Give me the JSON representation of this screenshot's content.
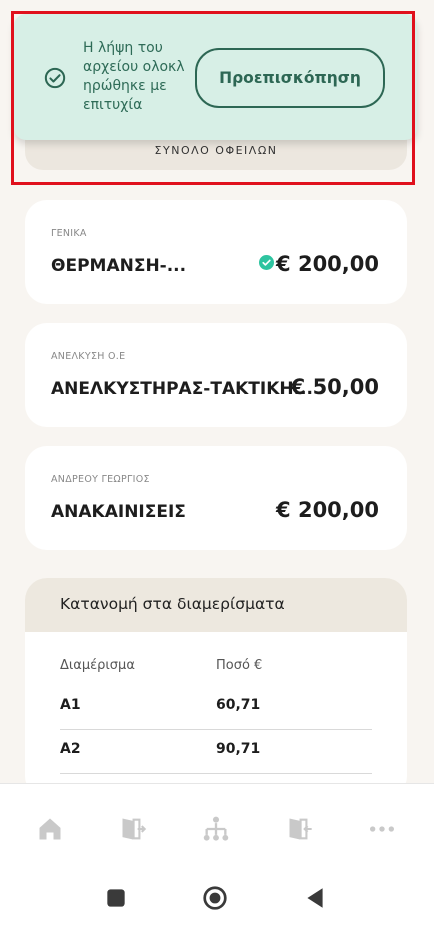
{
  "summary": {
    "label": "ΣΥΝΟΛΟ ΟΦΕΙΛΩΝ"
  },
  "toast": {
    "message_line1": "Η λήψη του",
    "message_line2": "αρχείου ολοκλ",
    "message_line3": "ηρώθηκε με",
    "message_line4": "επιτυχία",
    "preview_label": "Προεπισκόπηση",
    "icon": "check-circle-icon"
  },
  "expenses": [
    {
      "category": "ΓΕΝΙΚΑ",
      "title": "ΘΕΡΜΑΝΣΗ-...",
      "amount": "€ 200,00",
      "paid_icon": "check-badge-icon"
    },
    {
      "category": "ΑΝΕΛΚΥΣΗ Ο.Ε",
      "title": "ΑΝΕΛΚΥΣΤΗΡΑΣ-ΤΑΚΤΙΚΗ...",
      "amount": "€ 50,00"
    },
    {
      "category": "ΑΝΔΡΕΟΥ ΓΕΩΡΓΙΟΣ",
      "title": "ΑΝΑΚΑΙΝΙΣΕΙΣ",
      "amount": "€ 200,00"
    }
  ],
  "allocation": {
    "title": "Κατανομή στα διαμερίσματα",
    "columns": [
      "Διαμέρισμα",
      "Ποσό €"
    ],
    "rows": [
      {
        "apartment": "A1",
        "amount": "60,71"
      },
      {
        "apartment": "A2",
        "amount": "90,71"
      }
    ]
  },
  "bottom_nav": {
    "items": [
      "home-icon",
      "door-in-icon",
      "hierarchy-icon",
      "door-out-icon",
      "more-icon"
    ]
  },
  "system_bar": {
    "items": [
      "recents-square-icon",
      "home-circle-icon",
      "back-triangle-icon"
    ]
  },
  "colors": {
    "accent": "#2d6754",
    "toast_bg": "#d7efe6",
    "highlight_frame": "#e0101c",
    "paid": "#2ec4a0"
  }
}
